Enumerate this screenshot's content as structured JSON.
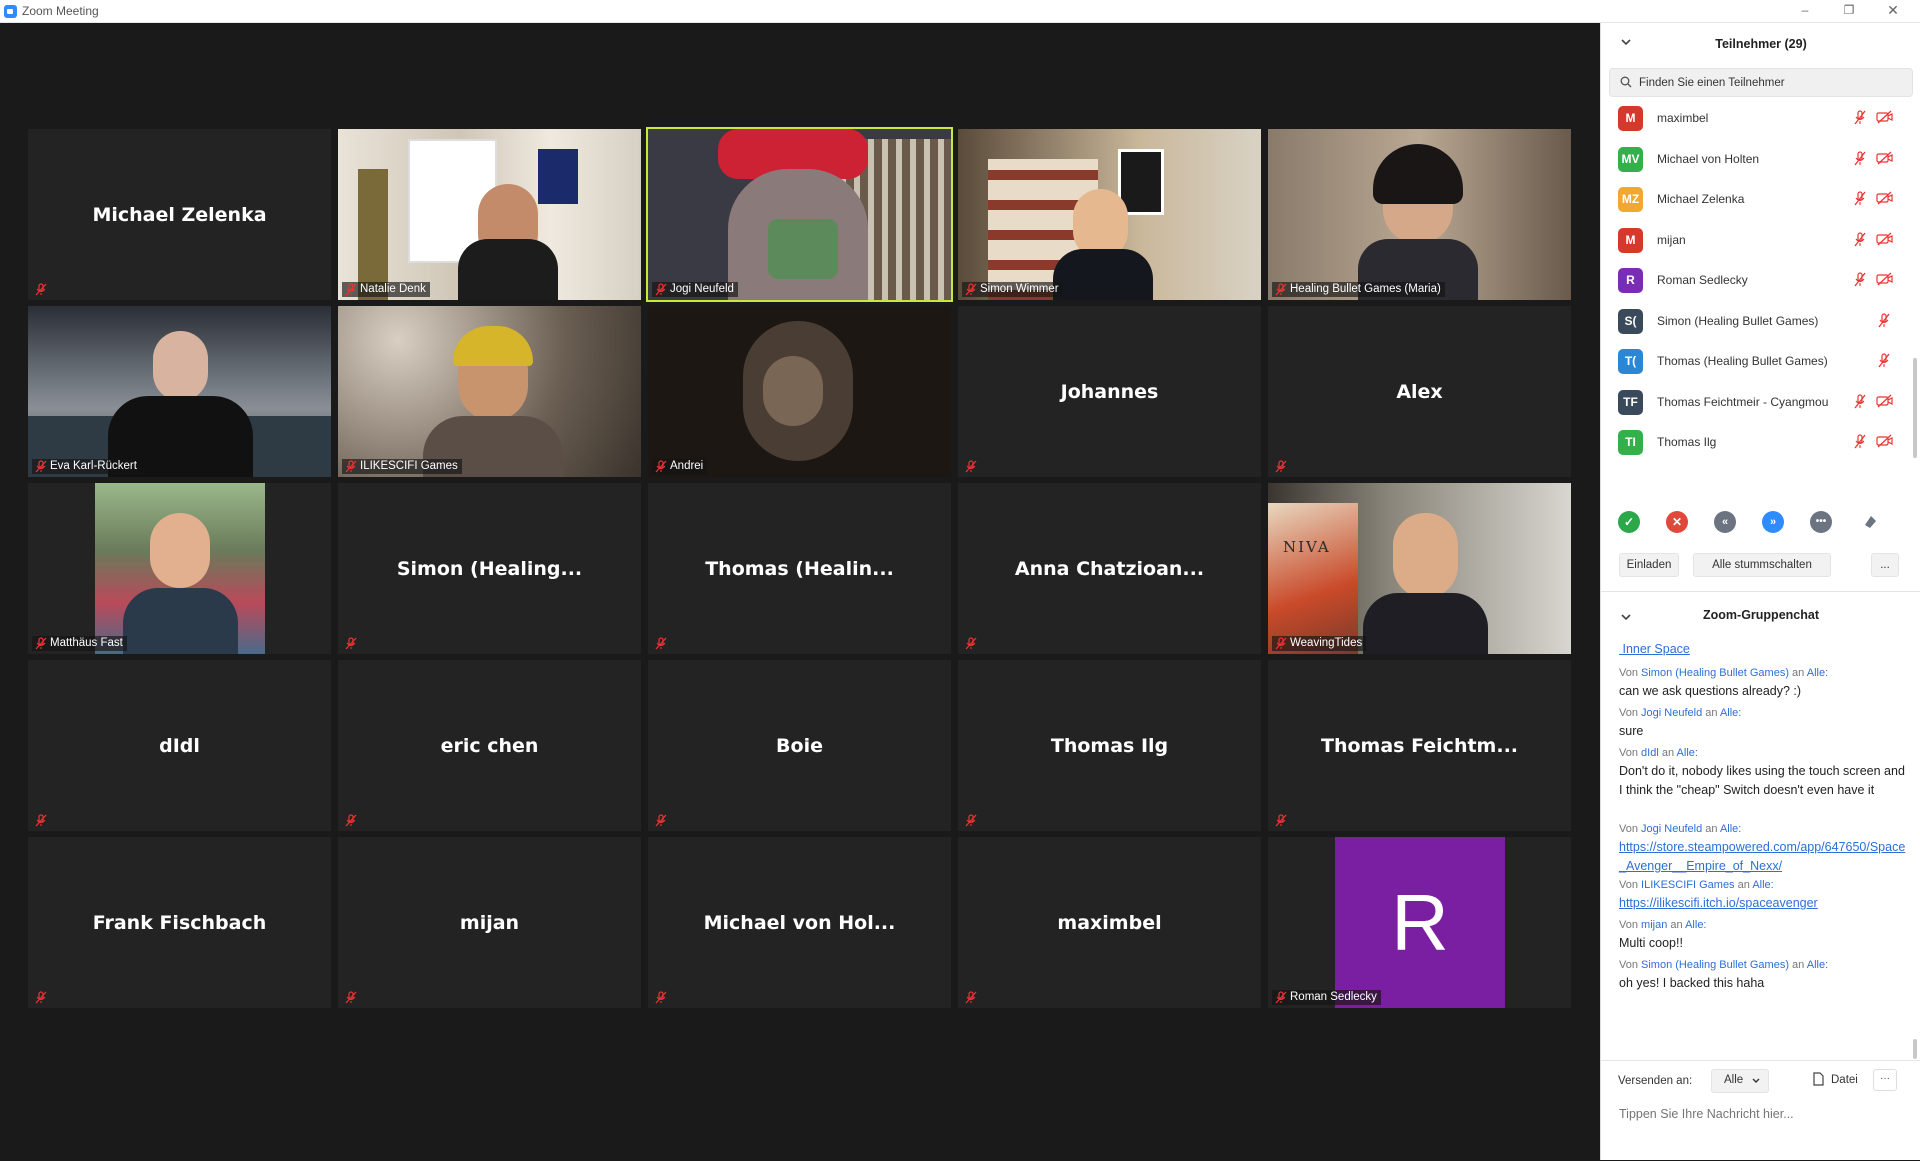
{
  "window": {
    "title": "Zoom Meeting"
  },
  "grid": {
    "tiles": [
      {
        "label": "",
        "center": "Michael Zelenka"
      },
      {
        "label": "Natalie Denk",
        "center": ""
      },
      {
        "label": "Jogi Neufeld",
        "center": ""
      },
      {
        "label": "Simon Wimmer",
        "center": ""
      },
      {
        "label": "Healing Bullet Games (Maria)",
        "center": ""
      },
      {
        "label": "Eva Karl-Rückert",
        "center": ""
      },
      {
        "label": "ILIKESCIFI Games",
        "center": ""
      },
      {
        "label": "Andrei",
        "center": ""
      },
      {
        "label": "",
        "center": "Johannes"
      },
      {
        "label": "",
        "center": "Alex"
      },
      {
        "label": "Matthäus Fast",
        "center": ""
      },
      {
        "label": "",
        "center": "Simon  (Healing..."
      },
      {
        "label": "",
        "center": "Thomas  (Healin..."
      },
      {
        "label": "",
        "center": "Anna  Chatzioan..."
      },
      {
        "label": "WeavingTides",
        "center": ""
      },
      {
        "label": "",
        "center": "dIdl"
      },
      {
        "label": "",
        "center": "eric chen"
      },
      {
        "label": "",
        "center": "Boie"
      },
      {
        "label": "",
        "center": "Thomas Ilg"
      },
      {
        "label": "",
        "center": "Thomas  Feichtm..."
      },
      {
        "label": "",
        "center": "Frank Fischbach"
      },
      {
        "label": "",
        "center": "mijan"
      },
      {
        "label": "",
        "center": "Michael von Hol..."
      },
      {
        "label": "",
        "center": "maximbel"
      },
      {
        "label": "Roman Sedlecky",
        "center": "",
        "avatar_letter": "R"
      }
    ],
    "art": {
      "niva_text": "NIVA"
    }
  },
  "participants": {
    "title": "Teilnehmer (29)",
    "search_placeholder": "Finden Sie einen Teilnehmer",
    "list": [
      {
        "initials": "M",
        "name": "maximbel",
        "color": "#d6392b"
      },
      {
        "initials": "MV",
        "name": "Michael von Holten",
        "color": "#34b04a"
      },
      {
        "initials": "MZ",
        "name": "Michael Zelenka",
        "color": "#f0a830"
      },
      {
        "initials": "M",
        "name": "mijan",
        "color": "#d6392b"
      },
      {
        "initials": "R",
        "name": "Roman Sedlecky",
        "color": "#7b2cb5"
      },
      {
        "initials": "S(",
        "name": "Simon (Healing Bullet Games)",
        "color": "#3a4a5a"
      },
      {
        "initials": "T(",
        "name": "Thomas (Healing Bullet Games)",
        "color": "#2b87d3"
      },
      {
        "initials": "TF",
        "name": "Thomas Feichtmeir - Cyangmou",
        "color": "#3a4a5a"
      },
      {
        "initials": "TI",
        "name": "Thomas Ilg",
        "color": "#34b04a"
      }
    ],
    "buttons": {
      "invite": "Einladen",
      "mute_all": "Alle stummschalten",
      "more": "..."
    }
  },
  "chat": {
    "title": "Zoom-Gruppenchat",
    "first_link": " Inner Space",
    "from_word": "Von",
    "to_word": "an",
    "to_all": "Alle:",
    "messages": [
      {
        "from": "Simon (Healing Bullet Games)",
        "text": "can we ask questions already? :)"
      },
      {
        "from": "Jogi Neufeld",
        "text": "sure"
      },
      {
        "from": "dIdl",
        "text": "Don't do it, nobody likes using the touch screen and I think the \"cheap\" Switch doesn't even have it"
      },
      {
        "from": "Jogi Neufeld",
        "link": "https://store.steampowered.com/app/647650/Space_Avenger__Empire_of_Nexx/"
      },
      {
        "from": "ILIKESCIFI Games",
        "link": "https://ilikescifi.itch.io/spaceavenger"
      },
      {
        "from": "mijan",
        "text": "Multi coop!!"
      },
      {
        "from": "Simon (Healing Bullet Games)",
        "text": "oh yes! I backed this haha"
      }
    ],
    "send_to_label": "Versenden an:",
    "send_to_value": "Alle",
    "file_label": "Datei",
    "more": "···",
    "input_placeholder": "Tippen Sie Ihre Nachricht hier..."
  }
}
